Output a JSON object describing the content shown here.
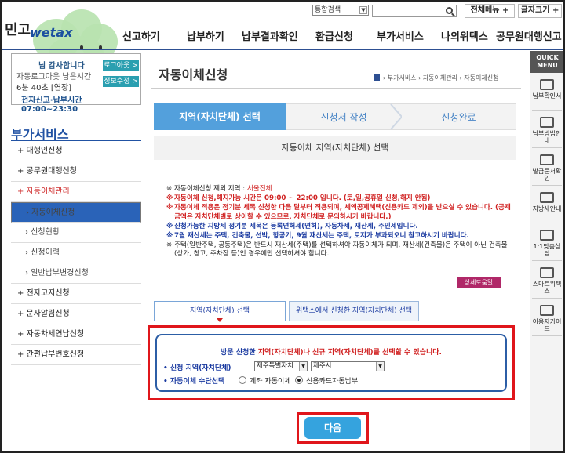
{
  "topbar": {
    "search_scope": "통합검색",
    "all_menu_label": "전체메뉴 +",
    "font_size_label": "글자크기 +"
  },
  "logo": {
    "prefix": "민고",
    "brand": "wetax"
  },
  "gnb": {
    "items": [
      "신고하기",
      "납부하기",
      "납부결과확인",
      "환급신청",
      "부가서비스",
      "나의위택스",
      "공무원대행신고"
    ]
  },
  "login": {
    "name": "님 감사합니다",
    "line1": "자동로그아웃 남은시간",
    "line2": "6분 40초 [연장]",
    "time": "전자신고·납부시간 07:00~23:30",
    "logout_label": "로그아웃 >",
    "edit_label": "정보수정 >"
  },
  "lnb": {
    "title": "부가서비스",
    "items": [
      {
        "label": "+ 대행인신청"
      },
      {
        "label": "+ 공무원대행신청"
      },
      {
        "label": "+ 자동이체관리"
      },
      {
        "label": "› 자동이체신청"
      },
      {
        "label": "› 신청현황"
      },
      {
        "label": "› 신청이력"
      },
      {
        "label": "› 일반납부변경신청"
      },
      {
        "label": "+ 전자고지신청"
      },
      {
        "label": "+ 문자알림신청"
      },
      {
        "label": "+ 자동차세연납신청"
      },
      {
        "label": "+ 간편납부번호신청"
      }
    ]
  },
  "quick": {
    "head": "QUICK MENU",
    "items": [
      "납부확인서",
      "납부방법안내",
      "발급문서확인",
      "지방세안내",
      "1:1맞춤상담",
      "스마트위택스",
      "이용자가이드"
    ]
  },
  "page": {
    "title": "자동이체신청",
    "breadcrumb": "› 부가서비스 › 자동이체관리 › 자동이체신청",
    "steps": [
      "지역(자치단체) 선택",
      "신청서 작성",
      "신청완료"
    ],
    "subtitle": "자동이체 지역(자치단체) 선택"
  },
  "notes": [
    {
      "style": "black",
      "text": "자동이체신청 제외 지역 : ",
      "hl": "서울전체"
    },
    {
      "style": "red",
      "text": "자동이체 신청,해지가능 시간은 09:00 ~ 22:00 입니다. (토,일,공휴일 신청,해지 안됨)"
    },
    {
      "style": "red",
      "text": "자동이체 적용은 정기분 세목 신청한 다음 달부터 적용되며, 세액공제혜택(신용카드 제외)을 받으실 수 있습니다. (공제금액은 자치단체별로 상이할 수 있으므로, 자치단체로 문의하시기 바랍니다.)"
    },
    {
      "style": "blue",
      "text": "신청가능한 지방세 정기분 세목은 등록면허세(면허), 자동차세, 재산세, 주민세입니다."
    },
    {
      "style": "blue",
      "text": "7월 재산세는 주택, 건축물, 선박, 항공기, 9월 재산세는 주택, 토지가 부과되오니 참고하시기 바랍니다."
    },
    {
      "style": "black",
      "text": "주택(일반주택, 공동주택)은 반드시 재산세(주택)를 선택하셔야 자동이체가 되며, 재산세(건축물)은 주택이 아닌 건축물(상가, 창고, 주차장 등)인 경우에만 선택하셔야 합니다."
    }
  ],
  "note_marker": "※",
  "detail_label": "상세도움말",
  "tabs": [
    "지역(자치단체) 선택",
    "위택스에서 신청한 지역(자치단체) 선택"
  ],
  "panel": {
    "head_pre": "방문 신청한 ",
    "head_hl": "지역(자치단체)나 신규 지역(자치단체)를 선택할 수 있습니다.",
    "region_label": "• 신청 지역(자치단체)",
    "region1": "제주특별자치",
    "region2": "제주시",
    "method_label": "• 자동이체 수단선택",
    "opt1": "계좌 자동이체",
    "opt2": "신용카드자동납부"
  },
  "next_label": "다음"
}
